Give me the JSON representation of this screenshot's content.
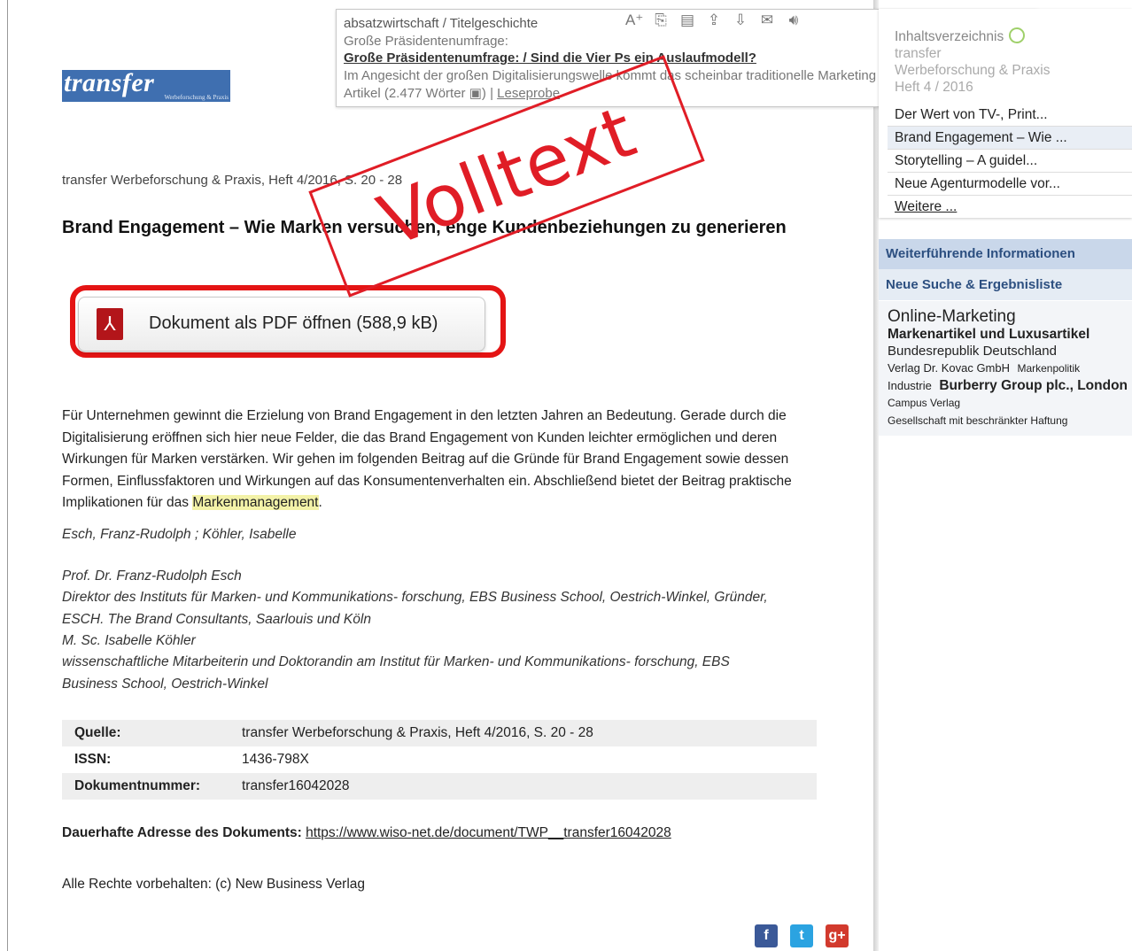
{
  "logo": {
    "word": "transfer",
    "sub": "Werbeforschung & Praxis"
  },
  "tooltip": {
    "line1": "absatzwirtschaft / Titelgeschichte",
    "line2": "Große Präsidentenumfrage:",
    "line3": "Große Präsidentenumfrage: / Sind die Vier Ps ein Auslaufmodell?",
    "line4": "Im Angesicht der großen Digitalisierungswelle kommt das scheinbar traditionelle Marketing immer mehr ...",
    "line5_pre": "Artikel (2.477 Wörter ",
    "line5_post": ") | ",
    "line5_link": "Leseprobe",
    "icons": [
      "font-size-icon",
      "copy-icon",
      "save-icon",
      "upload-icon",
      "download-icon",
      "mail-icon",
      "speaker-icon"
    ]
  },
  "stamp": "Volltext",
  "article": {
    "source_line": "transfer Werbeforschung & Praxis, Heft 4/2016, S. 20 - 28",
    "title": "Brand Engagement – Wie Marken versuchen, enge Kundenbeziehungen zu generieren",
    "pdf_button": "Dokument als PDF öffnen (588,9 kB)",
    "abstract_pre": "Für Unternehmen gewinnt die Erzielung von Brand Engagement in den letzten Jahren an Bedeutung. Gerade durch die Digitalisierung eröffnen sich hier neue Felder, die das Brand Engagement von Kunden leichter ermöglichen und deren Wirkungen für Marken verstärken. Wir gehen im folgenden Beitrag auf die Gründe für Brand Engagement sowie dessen Formen, Einflussfaktoren und Wirkungen auf das Konsumentenverhalten ein. Abschließend bietet der Beitrag praktische Implikationen für das ",
    "abstract_highlight": "Markenmanagement",
    "abstract_post": ".",
    "authors": "Esch, Franz-Rudolph ; Köhler, Isabelle",
    "bio": [
      "Prof. Dr. Franz-Rudolph Esch",
      "Direktor des Instituts für Marken- und Kommunikations- forschung, EBS Business School, Oestrich-Winkel, Gründer,",
      "ESCH. The Brand Consultants, Saarlouis und Köln",
      "M. Sc. Isabelle Köhler",
      "wissenschaftliche Mitarbeiterin und Doktorandin am Institut für Marken- und Kommunikations- forschung, EBS",
      "Business School, Oestrich-Winkel"
    ],
    "meta": [
      {
        "key": "Quelle:",
        "value": "transfer Werbeforschung & Praxis, Heft 4/2016, S. 20 - 28"
      },
      {
        "key": "ISSN:",
        "value": "1436-798X"
      },
      {
        "key": "Dokumentnummer:",
        "value": "transfer16042028"
      }
    ],
    "permalink_label": "Dauerhafte Adresse des Dokuments:",
    "permalink_url": "https://www.wiso-net.de/document/TWP__transfer16042028",
    "rights": "Alle Rechte vorbehalten: (c) New Business Verlag"
  },
  "social": {
    "facebook": "f",
    "twitter": "t",
    "googleplus": "g+"
  },
  "sidebar": {
    "toc_title": "Inhaltsverzeichnis",
    "toc_sub1": "transfer",
    "toc_sub2": "Werbeforschung & Praxis",
    "toc_sub3": "Heft 4 / 2016",
    "toc_items": [
      "Der Wert von TV-, Print...",
      "Brand Engagement – Wie ...",
      "Storytelling – A guidel...",
      "Neue Agenturmodelle vor...",
      "Weitere ..."
    ],
    "info_title": "Weiterführende Informationen",
    "new_search": "Neue Suche & Ergebnisliste",
    "tags": [
      "Online-Marketing",
      "Markenartikel und Luxusartikel",
      "Bundesrepublik Deutschland",
      "Verlag Dr. Kovac GmbH",
      "Markenpolitik",
      "Industrie",
      "Burberry Group plc., London",
      "Campus Verlag",
      "Gesellschaft mit beschränkter Haftung"
    ]
  },
  "colors": {
    "stamp_red": "#e01d26",
    "logo_blue": "#3f6fb0",
    "sidebar_head": "#c9d7ea",
    "highlight": "#f3f2a8"
  }
}
